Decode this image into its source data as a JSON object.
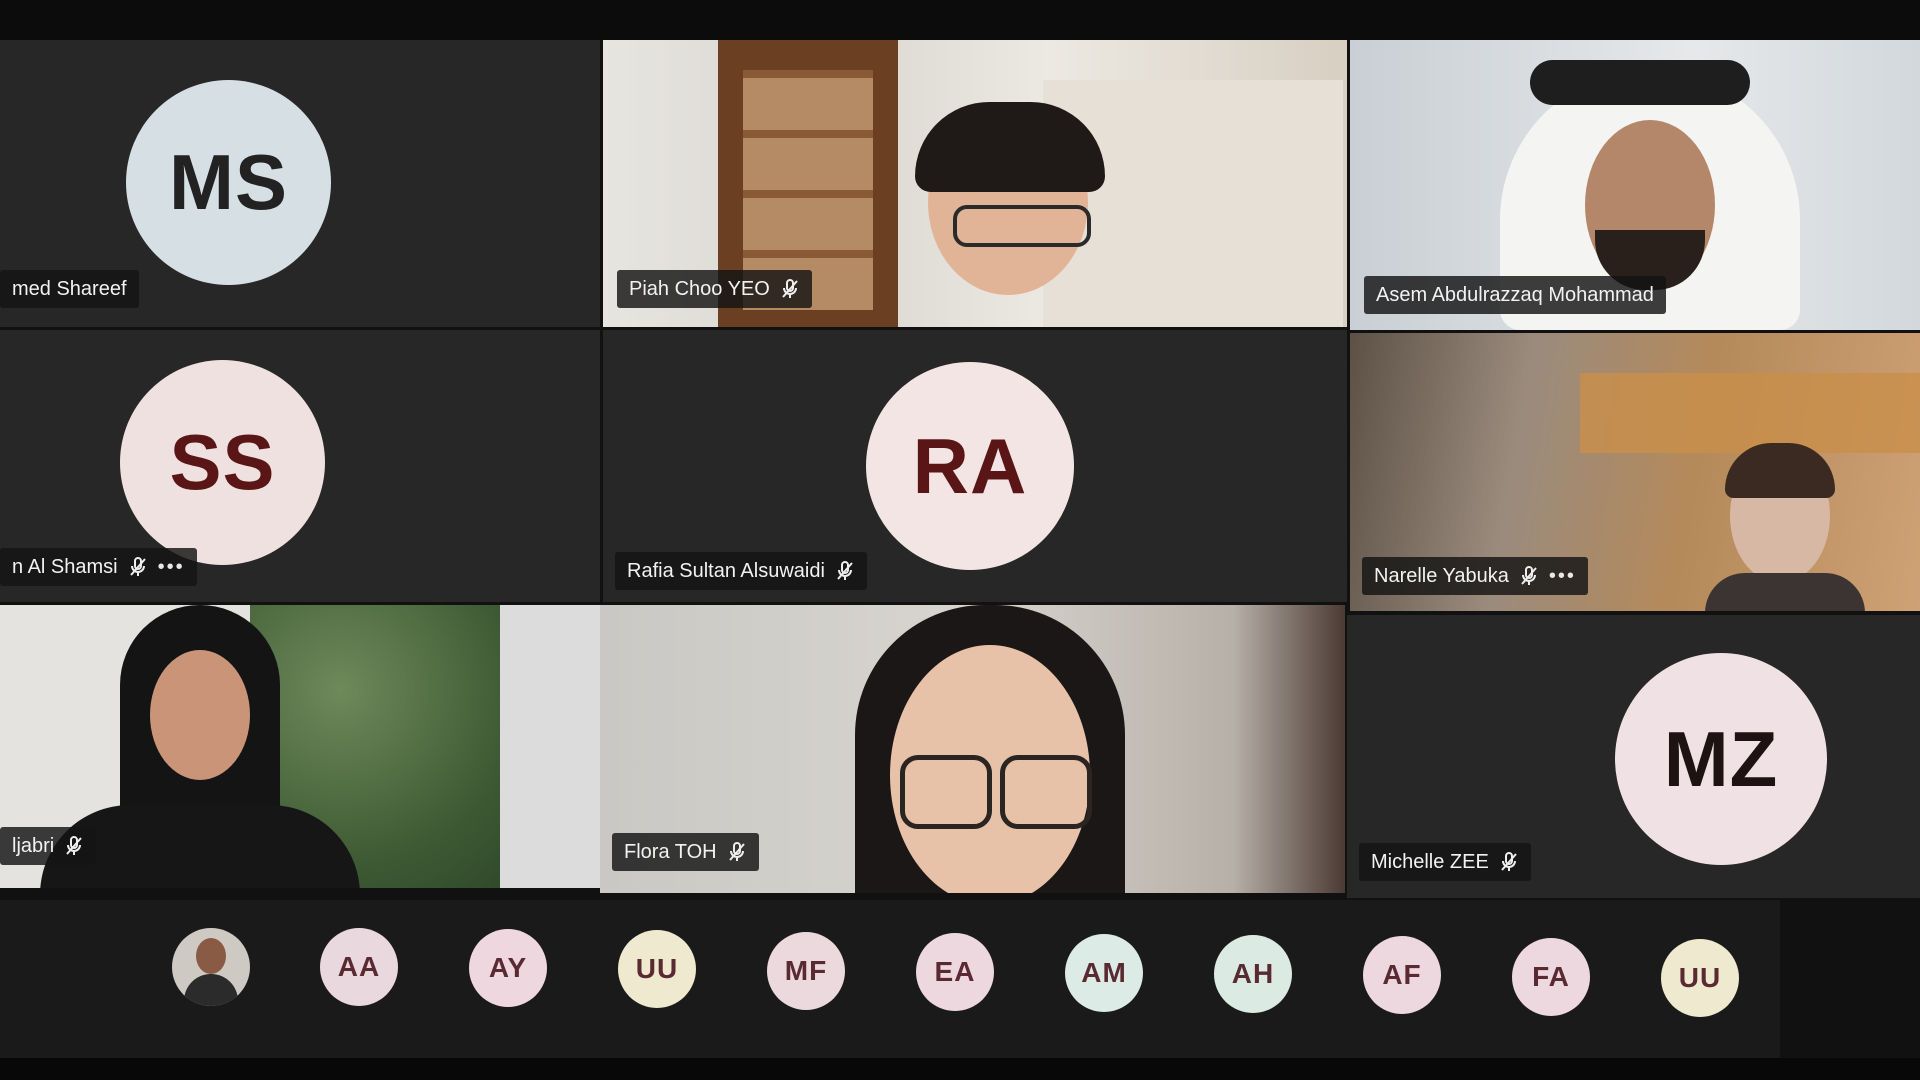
{
  "participants": {
    "ms": {
      "initials": "MS",
      "name": "med Shareef"
    },
    "piah": {
      "name": "Piah Choo YEO"
    },
    "asem": {
      "name": "Asem Abdulrazzaq Mohammad"
    },
    "ss": {
      "initials": "SS",
      "name": "n Al Shamsi"
    },
    "ra": {
      "initials": "RA",
      "name": "Rafia Sultan Alsuwaidi"
    },
    "narelle": {
      "name": "Narelle Yabuka"
    },
    "jabri": {
      "name": "ljabri"
    },
    "flora": {
      "name": "Flora TOH"
    },
    "mz": {
      "initials": "MZ",
      "name": "Michelle ZEE"
    }
  },
  "overflow_strip": {
    "avatars": [
      {
        "initials": "AA",
        "color": "#ead8df"
      },
      {
        "initials": "AY",
        "color": "#eed7df"
      },
      {
        "initials": "UU",
        "color": "#efe9d0"
      },
      {
        "initials": "MF",
        "color": "#ecd9de"
      },
      {
        "initials": "EA",
        "color": "#eed8df"
      },
      {
        "initials": "AM",
        "color": "#dcebe5"
      },
      {
        "initials": "AH",
        "color": "#dbebe4"
      },
      {
        "initials": "AF",
        "color": "#eed8df"
      },
      {
        "initials": "FA",
        "color": "#eed8df"
      },
      {
        "initials": "UU",
        "color": "#efe9d0"
      }
    ]
  },
  "colors": {
    "avatar_text": "#5a1616",
    "avatar_ms_bg": "#d6dfe4",
    "avatar_ss_bg": "#efe1df",
    "avatar_ra_bg": "#f3e5e4",
    "avatar_mz_bg": "#f0e2e4",
    "strip_text": "#5a2a33"
  },
  "icons": {
    "muted_mic": "mic-off-icon",
    "more": "more-options-icon"
  }
}
